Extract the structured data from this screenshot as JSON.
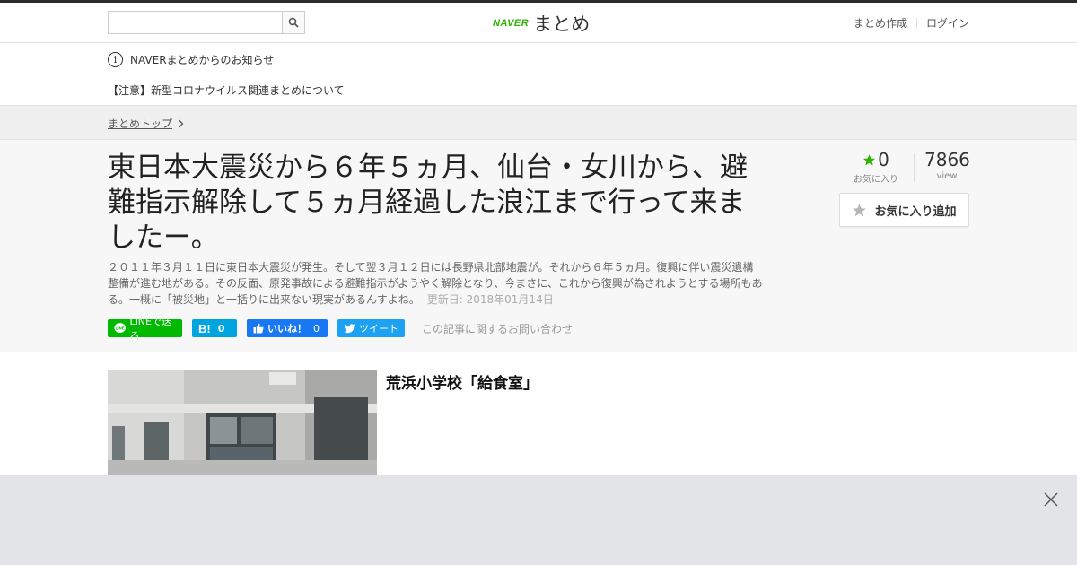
{
  "header": {
    "search_placeholder": "",
    "logo_brand": "NAVER",
    "logo_title": "まとめ",
    "links": {
      "create": "まとめ作成",
      "login": "ログイン"
    }
  },
  "notice": {
    "heading": "NAVERまとめからのお知らせ",
    "item": "【注意】新型コロナウイルス関連まとめについて"
  },
  "breadcrumb": {
    "label": "まとめトップ"
  },
  "article": {
    "title": "東日本大震災から６年５ヵ月、仙台・女川から、避難指示解除して５ヵ月経過した浪江まで行って来ましたー。",
    "description": "２０１１年３月１１日に東日本大震災が発生。そして翌３月１２日には長野県北部地震が。それから６年５ヵ月。復興に伴い震災遺構整備が進む地がある。その反面、原発事故による避難指示がようやく解除となり、今まさに、これから復興が為されようとする場所もある。一概に「被災地」と一括りに出来ない現実があるんすよね。",
    "updated": "更新日: 2018年01月14日",
    "favorites": {
      "count": "0",
      "label": "お気に入り"
    },
    "views": {
      "count": "7866",
      "label": "view"
    },
    "fav_add_label": "お気に入り追加"
  },
  "share": {
    "line": "LINEで送る",
    "hatena_count": "0",
    "fb_label": "いいね！",
    "fb_count": "0",
    "tweet": "ツイート",
    "inquiry": "この記事に関するお問い合わせ"
  },
  "content": {
    "heading": "荒浜小学校「給食室」"
  },
  "colors": {
    "accent_green": "#2db400",
    "line": "#00b900",
    "hatena": "#00a4de",
    "facebook": "#1877f2",
    "twitter": "#1da1f2"
  }
}
